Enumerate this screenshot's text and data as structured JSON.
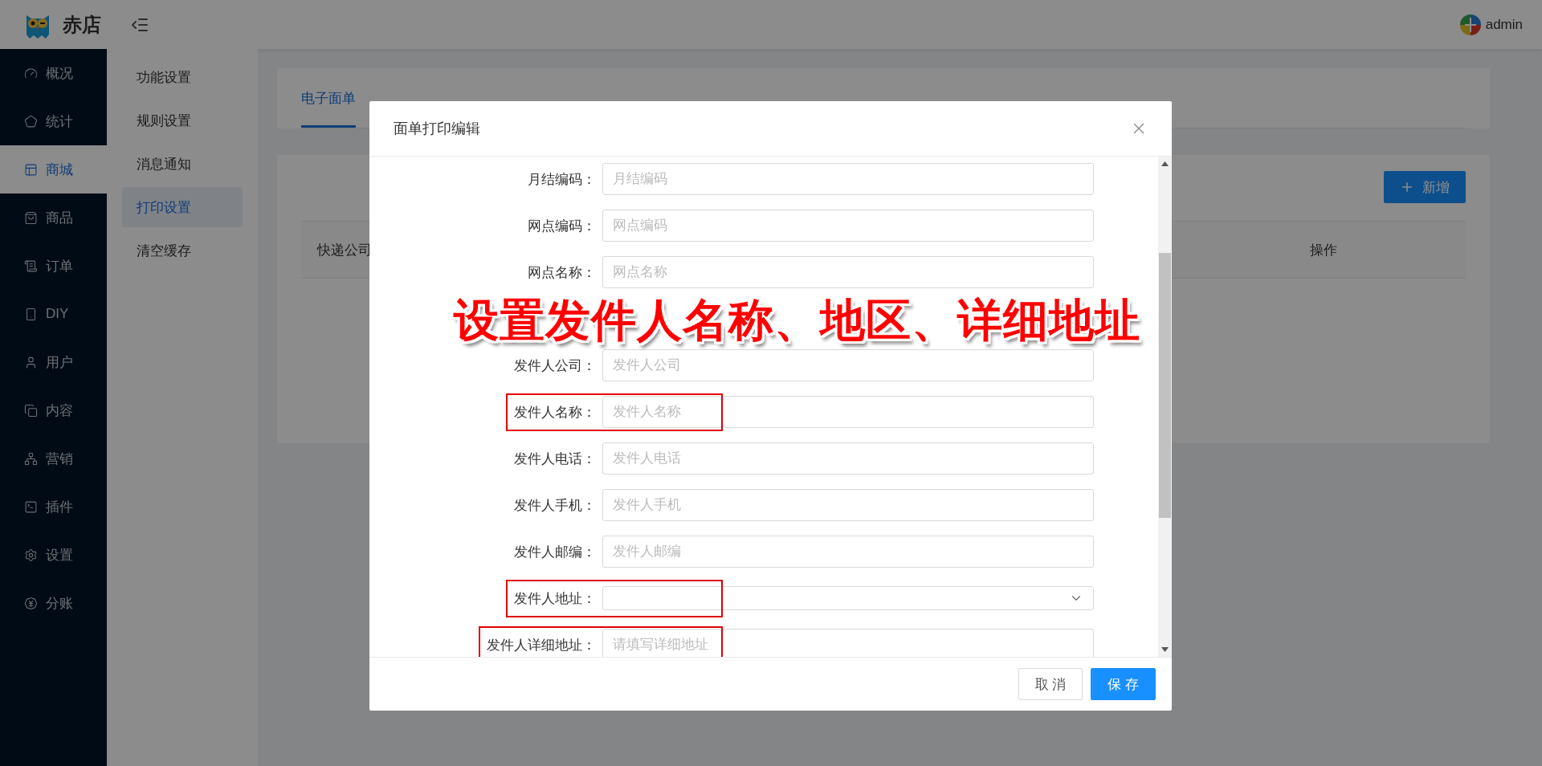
{
  "header": {
    "brand": "赤店",
    "user": "admin"
  },
  "sidebar": {
    "items": [
      {
        "label": "概况",
        "selected": false
      },
      {
        "label": "统计",
        "selected": false
      },
      {
        "label": "商城",
        "selected": true
      },
      {
        "label": "商品",
        "selected": false
      },
      {
        "label": "订单",
        "selected": false
      },
      {
        "label": "DIY",
        "selected": false
      },
      {
        "label": "用户",
        "selected": false
      },
      {
        "label": "内容",
        "selected": false
      },
      {
        "label": "营销",
        "selected": false
      },
      {
        "label": "插件",
        "selected": false
      },
      {
        "label": "设置",
        "selected": false
      },
      {
        "label": "分账",
        "selected": false
      }
    ]
  },
  "submenu": {
    "items": [
      {
        "label": "功能设置",
        "selected": false
      },
      {
        "label": "规则设置",
        "selected": false
      },
      {
        "label": "消息通知",
        "selected": false
      },
      {
        "label": "打印设置",
        "selected": true
      },
      {
        "label": "清空缓存",
        "selected": false
      }
    ]
  },
  "tabs": [
    {
      "label": "电子面单",
      "selected": true
    }
  ],
  "add_button": "新增",
  "table": {
    "columns": [
      "快递公司",
      "操作"
    ]
  },
  "dialog": {
    "title": "面单打印编辑",
    "fields": [
      {
        "kind": "input",
        "label": "月结编码：",
        "placeholder": "月结编码",
        "annotated": false
      },
      {
        "kind": "input",
        "label": "网点编码：",
        "placeholder": "网点编码",
        "annotated": false
      },
      {
        "kind": "input",
        "label": "网点名称：",
        "placeholder": "网点名称",
        "annotated": false
      },
      {
        "kind": "covered",
        "annotated": false
      },
      {
        "kind": "input",
        "label": "发件人公司：",
        "placeholder": "发件人公司",
        "annotated": false
      },
      {
        "kind": "input",
        "label": "发件人名称：",
        "placeholder": "发件人名称",
        "annotated": true
      },
      {
        "kind": "input",
        "label": "发件人电话：",
        "placeholder": "发件人电话",
        "annotated": false
      },
      {
        "kind": "input",
        "label": "发件人手机：",
        "placeholder": "发件人手机",
        "annotated": false
      },
      {
        "kind": "input",
        "label": "发件人邮编：",
        "placeholder": "发件人邮编",
        "annotated": false
      },
      {
        "kind": "select",
        "label": "发件人地址：",
        "annotated": true
      },
      {
        "kind": "input",
        "label": "发件人详细地址：",
        "placeholder": "请填写详细地址",
        "annotated": true
      }
    ],
    "buttons": [
      {
        "label": "取 消",
        "kind": "secondary"
      },
      {
        "label": "保 存",
        "kind": "primary"
      }
    ]
  },
  "annotation": {
    "text": "设置发件人名称、地区、详细地址"
  }
}
